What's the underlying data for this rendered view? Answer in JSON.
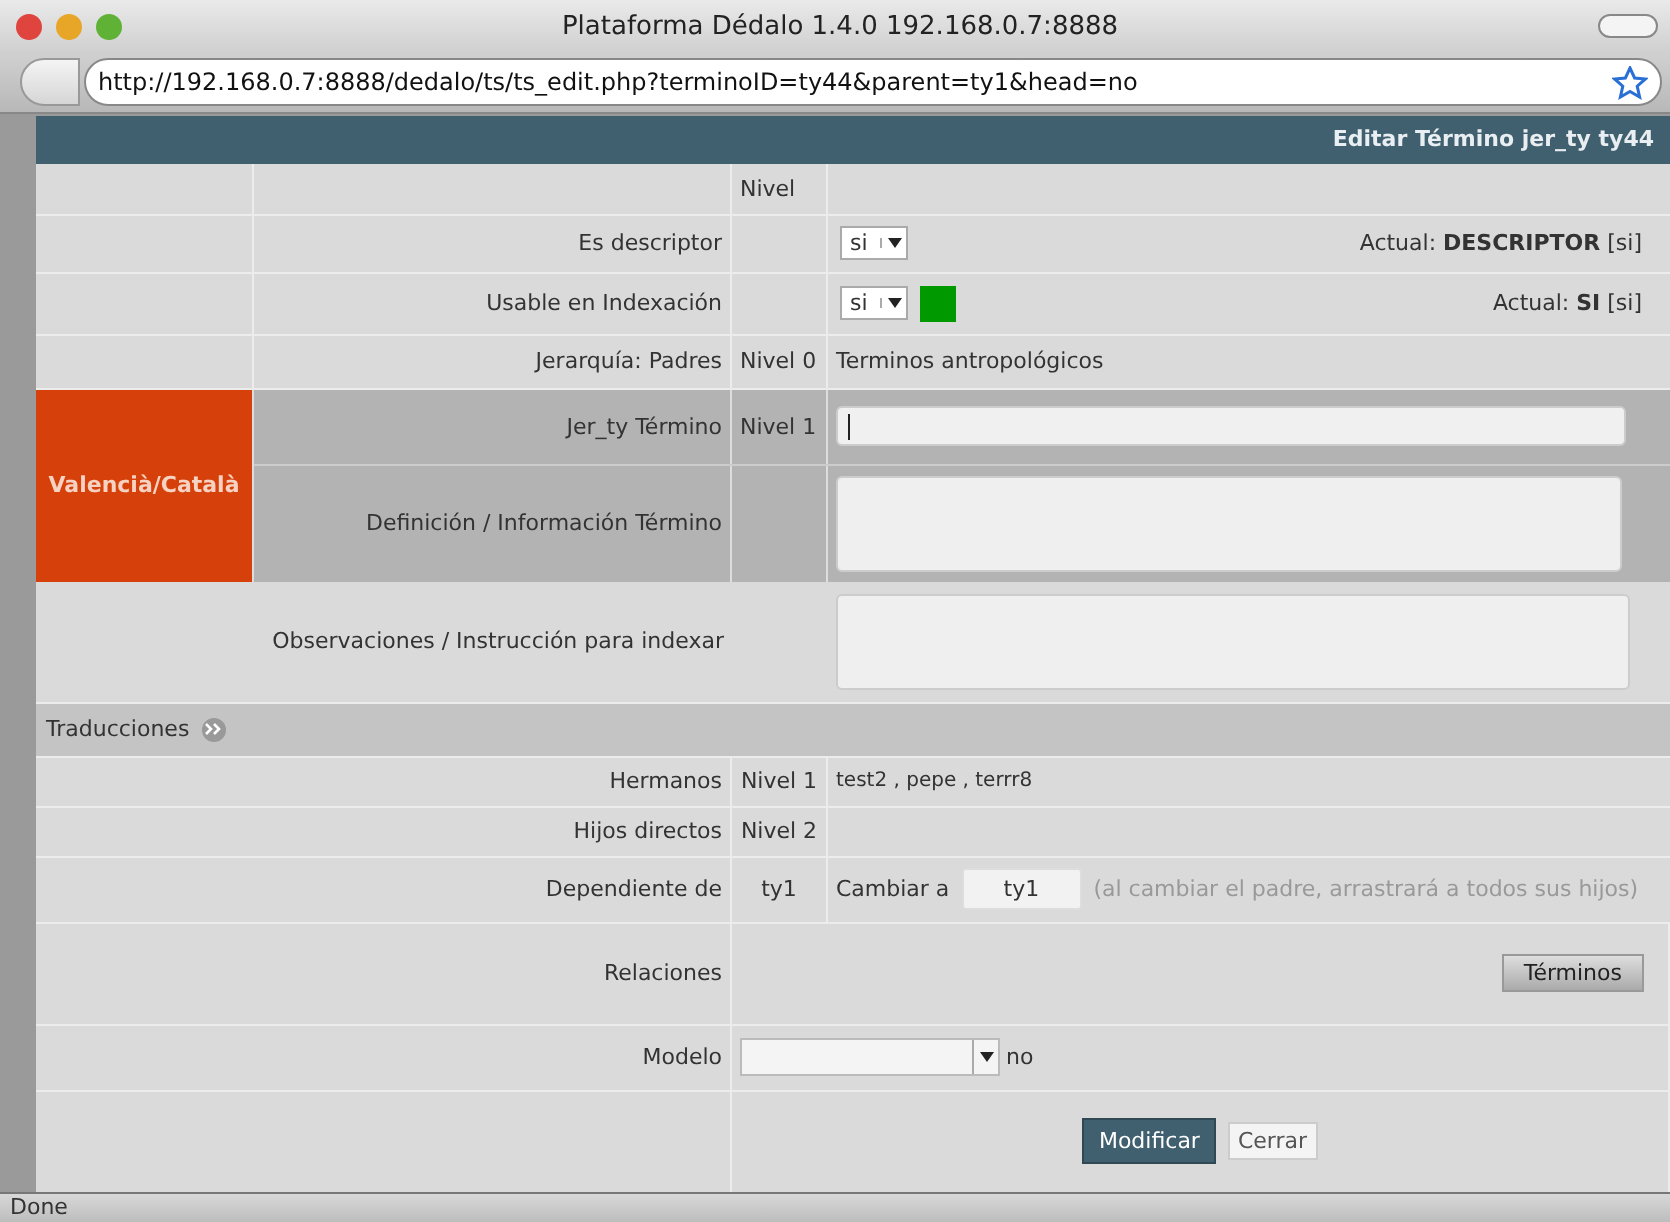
{
  "window": {
    "title": "Plataforma Dédalo 1.4.0 192.168.0.7:8888"
  },
  "address_bar": {
    "url": "http://192.168.0.7:8888/dedalo/ts/ts_edit.php?terminoID=ty44&parent=ty1&head=no"
  },
  "header": {
    "title": "Editar Término jer_ty ty44"
  },
  "top_rows": [
    {
      "kind": "heading",
      "level_label": "Nivel"
    },
    {
      "kind": "select",
      "label": "Es descriptor",
      "value": "si",
      "current": "Actual: **DESCRIPTOR** [si]"
    },
    {
      "kind": "select",
      "label": "Usable en Indexación",
      "value": "si",
      "color": "#009900",
      "current": "Actual: **SI** [si]"
    },
    {
      "kind": "text",
      "label": "Jerarquía: Padres",
      "level_label": "Nivel 0",
      "value": "Terminos antropológicos"
    }
  ],
  "language_section": {
    "language": "Valencià/Català",
    "rows": [
      {
        "kind": "input",
        "label": "Jer_ty Término",
        "level_label": "Nivel 1",
        "focused": true
      },
      {
        "kind": "textarea",
        "label": "Definición / Información Término"
      }
    ]
  },
  "observations": {
    "label": "Observaciones / Instrucción para indexar"
  },
  "translations": {
    "label": "Traducciones"
  },
  "bottom_rows": [
    {
      "kind": "text",
      "label": "Hermanos",
      "level_label": "Nivel 1",
      "value": "test2 , pepe , terrr8"
    },
    {
      "kind": "text",
      "label": "Hijos directos",
      "level_label": "Nivel 2"
    },
    {
      "kind": "parent",
      "label": "Dependiente de",
      "level_label": "ty1",
      "change_label": "Cambiar a",
      "change_value": "ty1",
      "note": "(al cambiar el padre, arrastrará a todos sus hijos)"
    },
    {
      "kind": "button",
      "label": "Relaciones",
      "button": "Términos"
    },
    {
      "kind": "dropdown",
      "label": "Modelo",
      "suffix": "no"
    }
  ],
  "buttons": [
    "Modificar",
    "Cerrar"
  ],
  "status_bar": "Done"
}
